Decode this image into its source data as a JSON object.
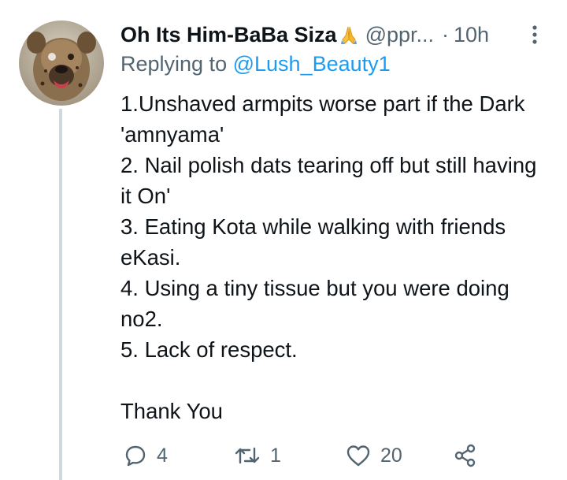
{
  "tweet": {
    "author_name": "Oh Its Him-BaBa Siza",
    "author_emoji": "folded-hands-icon",
    "handle": "@ppr...",
    "dot": "·",
    "time": "10h",
    "replying_prefix": "Replying to",
    "replying_to": "@Lush_Beauty1",
    "body_lines": [
      "1.Unshaved armpits worse part if the Dark 'amnyama'",
      "2. Nail polish dats tearing off but still having it On'",
      "3. Eating Kota while walking with friends eKasi.",
      "4. Using a tiny tissue but you were doing no2.",
      "5. Lack of respect."
    ],
    "closing": "Thank You"
  },
  "actions": {
    "reply_count": "4",
    "retweet_count": "1",
    "like_count": "20"
  },
  "colors": {
    "text": "#0f1419",
    "muted": "#536471",
    "link": "#1d9bf0",
    "thread_line": "#cfd9de"
  }
}
